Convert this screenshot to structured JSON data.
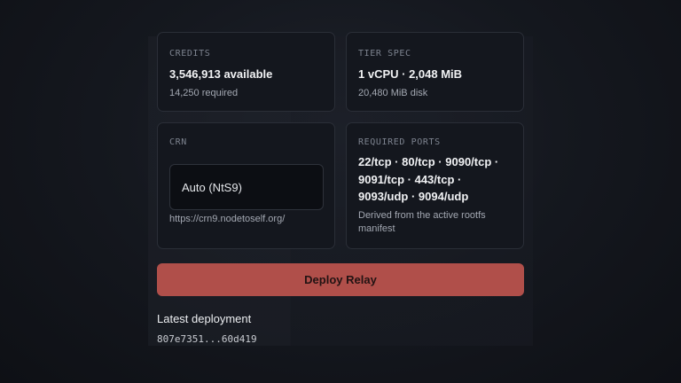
{
  "credits": {
    "label": "CREDITS",
    "available": "3,546,913 available",
    "required": "14,250 required"
  },
  "tier_spec": {
    "label": "TIER SPEC",
    "value": "1 vCPU · 2,048 MiB",
    "disk": "20,480 MiB disk"
  },
  "crn": {
    "label": "CRN",
    "selected": "Auto (NtS9)",
    "url": "https://crn9.nodetoself.org/"
  },
  "required_ports": {
    "label": "REQUIRED PORTS",
    "ports": "22/tcp · 80/tcp · 9090/tcp · 9091/tcp · 443/tcp · 9093/udp · 9094/udp",
    "note": "Derived from the active rootfs manifest"
  },
  "actions": {
    "deploy_label": "Deploy Relay"
  },
  "latest_deployment": {
    "title": "Latest deployment",
    "hash": "807e7351...60d419"
  },
  "colors": {
    "accent": "#b04f4a",
    "card_bg": "#14171e",
    "card_border": "#2a2e37"
  }
}
